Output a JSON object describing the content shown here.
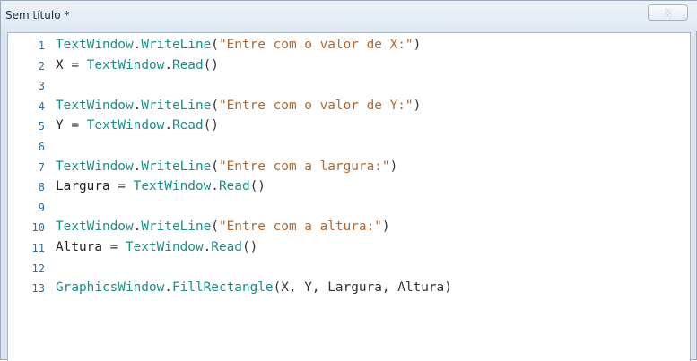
{
  "window": {
    "title": "Sem título *",
    "close_label": "x"
  },
  "editor": {
    "lines": [
      {
        "n": "1",
        "tokens": [
          [
            "obj",
            "TextWindow"
          ],
          [
            "dot",
            "."
          ],
          [
            "obj",
            "WriteLine"
          ],
          [
            "op",
            "("
          ],
          [
            "str",
            "\"Entre com o valor de X:\""
          ],
          [
            "op",
            ")"
          ]
        ]
      },
      {
        "n": "2",
        "tokens": [
          [
            "var",
            "X"
          ],
          [
            "op",
            " = "
          ],
          [
            "obj",
            "TextWindow"
          ],
          [
            "dot",
            "."
          ],
          [
            "obj",
            "Read"
          ],
          [
            "op",
            "()"
          ]
        ]
      },
      {
        "n": "3",
        "tokens": []
      },
      {
        "n": "4",
        "tokens": [
          [
            "obj",
            "TextWindow"
          ],
          [
            "dot",
            "."
          ],
          [
            "obj",
            "WriteLine"
          ],
          [
            "op",
            "("
          ],
          [
            "str",
            "\"Entre com o valor de Y:\""
          ],
          [
            "op",
            ")"
          ]
        ]
      },
      {
        "n": "5",
        "tokens": [
          [
            "var",
            "Y"
          ],
          [
            "op",
            " = "
          ],
          [
            "obj",
            "TextWindow"
          ],
          [
            "dot",
            "."
          ],
          [
            "obj",
            "Read"
          ],
          [
            "op",
            "()"
          ]
        ]
      },
      {
        "n": "6",
        "tokens": []
      },
      {
        "n": "7",
        "tokens": [
          [
            "obj",
            "TextWindow"
          ],
          [
            "dot",
            "."
          ],
          [
            "obj",
            "WriteLine"
          ],
          [
            "op",
            "("
          ],
          [
            "str",
            "\"Entre com a largura:\""
          ],
          [
            "op",
            ")"
          ]
        ]
      },
      {
        "n": "8",
        "tokens": [
          [
            "var",
            "Largura"
          ],
          [
            "op",
            " = "
          ],
          [
            "obj",
            "TextWindow"
          ],
          [
            "dot",
            "."
          ],
          [
            "obj",
            "Read"
          ],
          [
            "op",
            "()"
          ]
        ]
      },
      {
        "n": "9",
        "tokens": []
      },
      {
        "n": "10",
        "tokens": [
          [
            "obj",
            "TextWindow"
          ],
          [
            "dot",
            "."
          ],
          [
            "obj",
            "WriteLine"
          ],
          [
            "op",
            "("
          ],
          [
            "str",
            "\"Entre com a altura:\""
          ],
          [
            "op",
            ")"
          ]
        ]
      },
      {
        "n": "11",
        "tokens": [
          [
            "var",
            "Altura"
          ],
          [
            "op",
            " = "
          ],
          [
            "obj",
            "TextWindow"
          ],
          [
            "dot",
            "."
          ],
          [
            "obj",
            "Read"
          ],
          [
            "op",
            "()"
          ]
        ]
      },
      {
        "n": "12",
        "tokens": []
      },
      {
        "n": "13",
        "tokens": [
          [
            "obj",
            "GraphicsWindow"
          ],
          [
            "dot",
            "."
          ],
          [
            "obj",
            "FillRectangle"
          ],
          [
            "op",
            "(X, Y, Largura, Altura)"
          ]
        ]
      }
    ]
  }
}
